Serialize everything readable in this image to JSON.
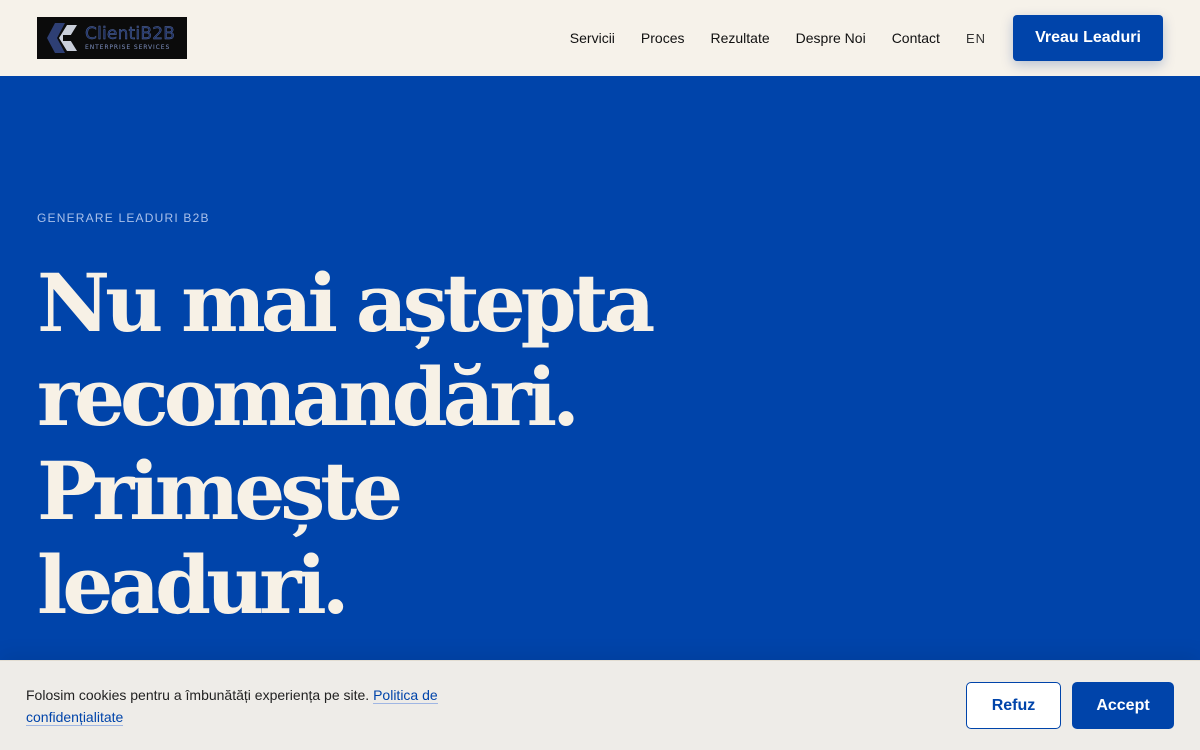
{
  "header": {
    "logo": {
      "name": "ClientiB2B",
      "sub": "ENTERPRISE SERVICES"
    },
    "nav": [
      {
        "label": "Servicii"
      },
      {
        "label": "Proces"
      },
      {
        "label": "Rezultate"
      },
      {
        "label": "Despre Noi"
      },
      {
        "label": "Contact"
      }
    ],
    "lang": "EN",
    "cta": "Vreau Leaduri"
  },
  "hero": {
    "eyebrow": "GENERARE LEADURI B2B",
    "headline": [
      "Nu mai aștepta",
      "recomandări.",
      "Primește",
      "leaduri."
    ]
  },
  "cookie": {
    "text": "Folosim cookies pentru a îmbunătăți experiența pe site.",
    "link": "Politica de confidențialitate",
    "refuse": "Refuz",
    "accept": "Accept"
  },
  "colors": {
    "brand": "#0044aa",
    "cream": "#f6f2ea"
  }
}
